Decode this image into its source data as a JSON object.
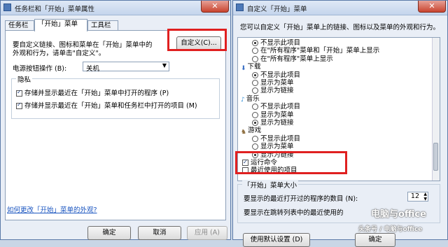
{
  "left_window": {
    "title": "任务栏和「开始」菜单属性",
    "close_label": "✕",
    "tabs": [
      "任务栏",
      "「开始」菜单",
      "工具栏"
    ],
    "intro_text_1": "要自定义链接、图标和菜单在「开始」菜单中的",
    "intro_text_2": "外观和行为，请单击\"自定义\"。",
    "customize_button": "自定义(C)...",
    "power_label": "电源按钮操作 (B):",
    "power_value": "关机",
    "privacy_group": "隐私",
    "privacy_opt1": "存储并显示最近在「开始」菜单中打开的程序 (P)",
    "privacy_opt2": "存储并显示最近在「开始」菜单和任务栏中打开的项目 (M)",
    "appearance_link": "如何更改「开始」菜单的外观?",
    "ok": "确定",
    "cancel": "取消",
    "apply": "应用 (A)"
  },
  "right_window": {
    "title": "自定义「开始」菜单",
    "close_label": "✕",
    "intro": "您可以自定义「开始」菜单上的链接、图标以及菜单的外观和行为。",
    "list": [
      {
        "type": "radio",
        "checked": true,
        "text": "不显示此项目"
      },
      {
        "type": "radio",
        "checked": false,
        "text": "在\"所有程序\"菜单和「开始」菜单上显示"
      },
      {
        "type": "radio",
        "checked": false,
        "text": "在\"所有程序\"菜单上显示"
      },
      {
        "type": "header",
        "icon": "download-icon",
        "text": "下载"
      },
      {
        "type": "radio",
        "checked": true,
        "text": "不显示此项目"
      },
      {
        "type": "radio",
        "checked": false,
        "text": "显示为菜单"
      },
      {
        "type": "radio",
        "checked": false,
        "text": "显示为链接"
      },
      {
        "type": "header",
        "icon": "music-icon",
        "text": "音乐"
      },
      {
        "type": "radio",
        "checked": false,
        "text": "不显示此项目"
      },
      {
        "type": "radio",
        "checked": false,
        "text": "显示为菜单"
      },
      {
        "type": "radio",
        "checked": true,
        "text": "显示为链接"
      },
      {
        "type": "header",
        "icon": "games-icon",
        "text": "游戏"
      },
      {
        "type": "radio",
        "checked": false,
        "text": "不显示此项目"
      },
      {
        "type": "radio",
        "checked": false,
        "text": "显示为菜单"
      },
      {
        "type": "radio",
        "checked": true,
        "text": "显示为链接"
      },
      {
        "type": "check",
        "checked": true,
        "text": "运行命令"
      },
      {
        "type": "check",
        "checked": false,
        "text": "最近使用的项目"
      }
    ],
    "start_size_group": "「开始」菜单大小",
    "recent_programs_label": "要显示的最近打开过的程序的数目 (N):",
    "recent_programs_value": "12",
    "jump_list_label": "要显示在跳转列表中的最近使用的",
    "use_default_button": "使用默认设置 (D)",
    "ok": "确定"
  },
  "watermark": {
    "line1": "电脑与office",
    "line2": "头条号 / 电脑与office"
  }
}
